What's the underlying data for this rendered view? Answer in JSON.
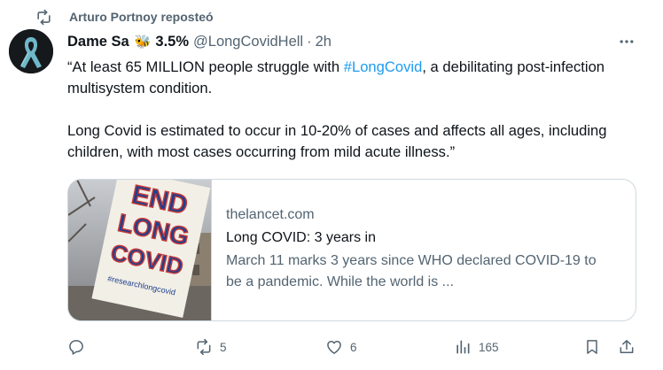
{
  "social_context": {
    "text": "Arturo Portnoy reposteó",
    "icon": "repost-icon"
  },
  "author": {
    "display_name": "Dame Sa",
    "emoji": "🐝",
    "name_suffix": "3.5%",
    "handle": "@LongCovidHell",
    "separator": "·",
    "time": "2h"
  },
  "body": {
    "p1_before": "“At least 65 MILLION people struggle with ",
    "hashtag": "#LongCovid",
    "p1_after": ", a debilitating post-infection multisystem condition.",
    "p2": "Long Covid is estimated to occur in 10-20% of cases and affects all ages, including children, with most cases occurring from mild acute illness.”"
  },
  "card": {
    "domain": "thelancet.com",
    "title": "Long COVID: 3 years in",
    "description": "March 11 marks 3 years since WHO declared COVID-19 to be a pandemic. While the world is ...",
    "image_text": {
      "line1": "END",
      "line2": "LONG",
      "line3": "COVID",
      "hashtag": "#researchlongcovid"
    }
  },
  "actions": {
    "reply_count": "",
    "repost_count": "5",
    "like_count": "6",
    "views_count": "165"
  },
  "colors": {
    "accent": "#1d9bf0",
    "secondary_text": "#536471",
    "primary_text": "#0f1419",
    "border": "#cfd9de"
  }
}
